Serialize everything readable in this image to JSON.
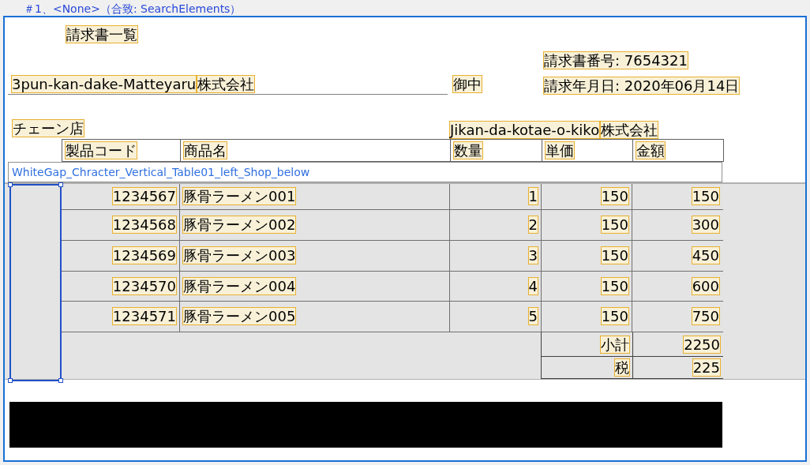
{
  "caption": "＃1、<None>（合致: SearchElements）",
  "document": {
    "title": "請求書一覧",
    "invoice_number": "請求書番号: 7654321",
    "invoice_date": "請求年月日: 2020年06月14日",
    "recipient": [
      "3pun-kan-dake-Matteyaru",
      "株式会社"
    ],
    "honorific": "御中",
    "store": "チェーン店",
    "sender": [
      "Jikan-da-kotae-o-kiko",
      "株式会社"
    ]
  },
  "table": {
    "columns": [
      "製品コード",
      "商品名",
      "数量",
      "単価",
      "金額"
    ],
    "overlay_label": "WhiteGap_Chracter_Vertical_Table01_left_Shop_below",
    "rows": [
      {
        "code": "1234567",
        "name": "豚骨ラーメン001",
        "qty": "1",
        "price": "150",
        "amount": "150"
      },
      {
        "code": "1234568",
        "name": "豚骨ラーメン002",
        "qty": "2",
        "price": "150",
        "amount": "300"
      },
      {
        "code": "1234569",
        "name": "豚骨ラーメン003",
        "qty": "3",
        "price": "150",
        "amount": "450"
      },
      {
        "code": "1234570",
        "name": "豚骨ラーメン004",
        "qty": "4",
        "price": "150",
        "amount": "600"
      },
      {
        "code": "1234571",
        "name": "豚骨ラーメン005",
        "qty": "5",
        "price": "150",
        "amount": "750"
      }
    ],
    "summary": [
      {
        "label": "小計",
        "value": "2250"
      },
      {
        "label": "税",
        "value": "225"
      }
    ]
  }
}
